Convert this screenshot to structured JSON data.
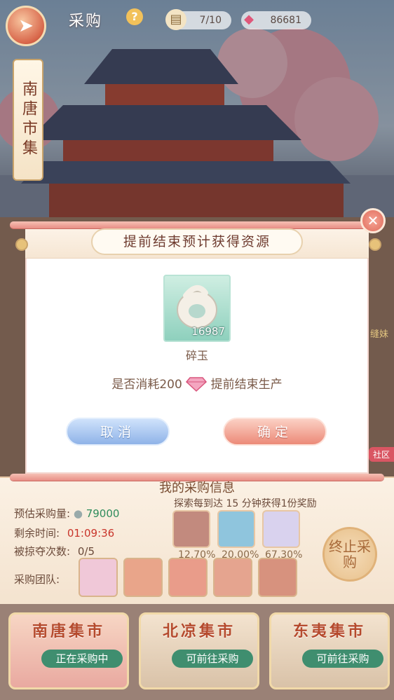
{
  "top_bar": {
    "title": "采购",
    "help": "?",
    "stamina": "7/10",
    "gems": "86681",
    "back_icon": "paper-plane-icon"
  },
  "location": "南唐市集",
  "side_label": "缝妹",
  "social_tab": "社区",
  "info_panel": {
    "title": "我的采购信息",
    "estimated_label": "预估采购量:",
    "estimated_value": "79000",
    "remaining_label": "剩余时间:",
    "remaining_value": "01:09:36",
    "raided_label": "被掠夺次数:",
    "raided_value": "0/5",
    "team_label": "采购团队:",
    "reward_text": "探索每到达 15 分钟获得1份奖励",
    "reward_pcts": [
      "12.70%",
      "20.00%",
      "67.30%"
    ],
    "stop_button": "终止采购"
  },
  "markets": [
    {
      "name": "南唐集市",
      "status": "正在采购中"
    },
    {
      "name": "北凉集市",
      "status": "可前往采购"
    },
    {
      "name": "东夷集市",
      "status": "可前往采购"
    }
  ],
  "modal": {
    "title": "提前结束预计获得资源",
    "item_count": "16987",
    "item_name": "碎玉",
    "confirm_prefix": "是否消耗200",
    "confirm_suffix": "提前结束生产",
    "cancel_label": "取消",
    "ok_label": "确定"
  },
  "colors": {
    "accent_red": "#e06c5b",
    "cancel_blue": "#8fb3e8",
    "ok_pink": "#ec8a78",
    "item_bg": "#8ed0bd"
  }
}
